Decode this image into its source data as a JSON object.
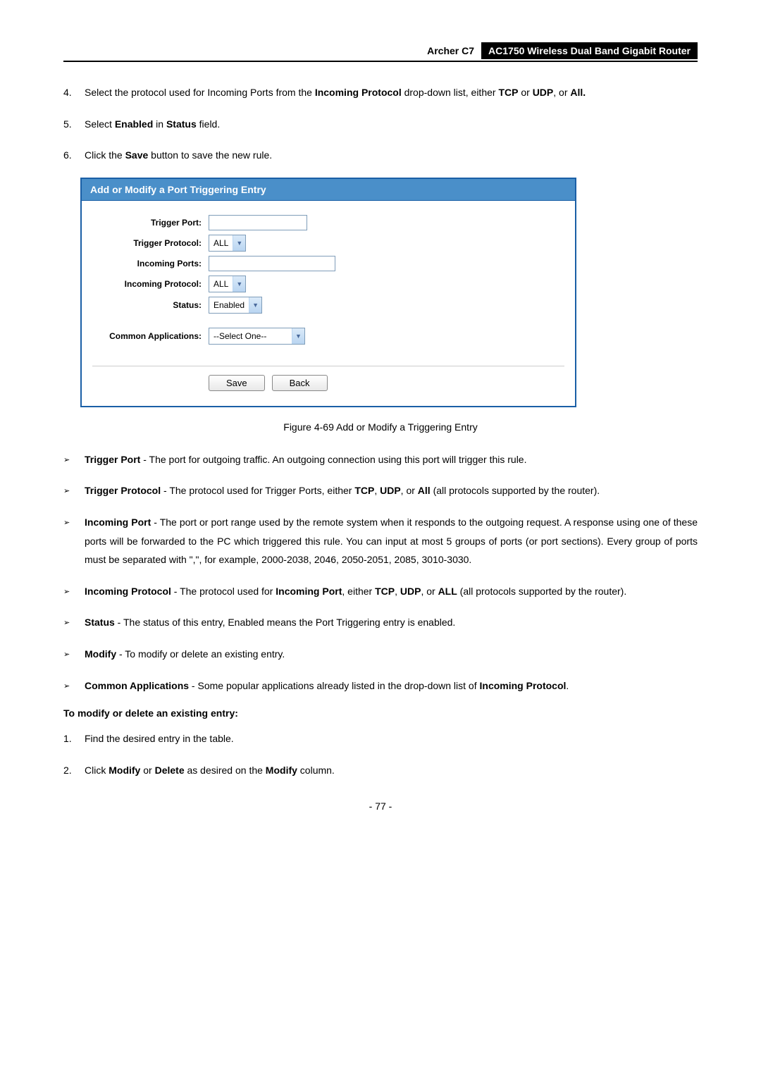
{
  "header": {
    "product": "Archer C7",
    "title": "AC1750 Wireless Dual Band Gigabit Router"
  },
  "steps_top": [
    {
      "num": "4.",
      "pre": "Select the protocol used for Incoming Ports from the ",
      "bold1": "Incoming Protocol",
      "mid": " drop-down list, either ",
      "bold2": "TCP",
      "mid2": " or ",
      "bold3": "UDP",
      "mid3": ", or ",
      "bold4": "All."
    },
    {
      "num": "5.",
      "pre": "Select ",
      "bold1": "Enabled",
      "mid": " in ",
      "bold2": "Status",
      "post": " field."
    },
    {
      "num": "6.",
      "pre": "Click the ",
      "bold1": "Save",
      "post": " button to save the new rule."
    }
  ],
  "figure": {
    "header": "Add or Modify a Port Triggering Entry",
    "labels": {
      "trigger_port": "Trigger Port:",
      "trigger_protocol": "Trigger Protocol:",
      "incoming_ports": "Incoming Ports:",
      "incoming_protocol": "Incoming Protocol:",
      "status": "Status:",
      "common_apps": "Common Applications:"
    },
    "values": {
      "trigger_protocol": "ALL",
      "incoming_protocol": "ALL",
      "status": "Enabled",
      "common_apps": "--Select One--"
    },
    "buttons": {
      "save": "Save",
      "back": "Back"
    },
    "caption": "Figure 4-69 Add or Modify a Triggering Entry"
  },
  "bullets": [
    {
      "bold": "Trigger Port",
      "text": " - The port for outgoing traffic. An outgoing connection using this port will trigger this rule."
    },
    {
      "bold": "Trigger Protocol",
      "text_parts": [
        " - The protocol used for Trigger Ports, either ",
        "TCP",
        ", ",
        "UDP",
        ", or ",
        "All",
        " (all protocols supported by the router)."
      ]
    },
    {
      "bold": "Incoming Port",
      "text": " - The port or port range used by the remote system when it responds to the outgoing request. A response using one of these ports will be forwarded to the PC which triggered this rule. You can input at most 5 groups of ports (or port sections). Every group of ports must be separated with \",\", for example, 2000-2038, 2046, 2050-2051, 2085, 3010-3030."
    },
    {
      "bold": "Incoming Protocol",
      "text_parts": [
        " - The protocol used for ",
        "Incoming Port",
        ", either ",
        "TCP",
        ", ",
        "UDP",
        ", or ",
        "ALL",
        " (all protocols supported by the router)."
      ]
    },
    {
      "bold": "Status",
      "text": " - The status of this entry, Enabled means the Port Triggering entry is enabled."
    },
    {
      "bold": "Modify",
      "text": " - To modify or delete an existing entry."
    },
    {
      "bold": "Common Applications",
      "text_parts": [
        " - Some popular applications already listed in the drop-down list of ",
        "Incoming Protocol",
        "."
      ]
    }
  ],
  "section_heading": "To modify or delete an existing entry:",
  "steps_bottom": [
    {
      "num": "1.",
      "text": "Find the desired entry in the table."
    },
    {
      "num": "2.",
      "pre": "Click ",
      "bold1": "Modify",
      "mid": " or ",
      "bold2": "Delete",
      "mid2": " as desired on the ",
      "bold3": "Modify",
      "post": " column."
    }
  ],
  "page_number": "- 77 -"
}
